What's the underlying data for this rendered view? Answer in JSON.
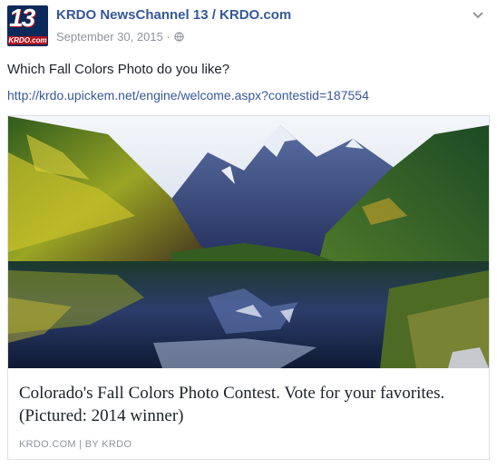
{
  "post": {
    "page_name": "KRDO NewsChannel 13 / KRDO.com",
    "date": "September 30, 2015 ·",
    "message": "Which Fall Colors Photo do you like?",
    "link": "http://krdo.upickem.net/engine/welcome.aspx?contestid=187554"
  },
  "logo": {
    "number": "13",
    "text": "KRDO.com"
  },
  "card": {
    "title": "Colorado's Fall Colors Photo Contest. Vote for your favorites. (Pictured: 2014 winner)",
    "domain": "KRDO.COM | BY KRDO"
  },
  "icons": {
    "privacy": "globe-icon",
    "options": "chevron-down-icon"
  },
  "colors": {
    "link": "#365899",
    "meta": "#90949c",
    "text": "#1d2129"
  }
}
